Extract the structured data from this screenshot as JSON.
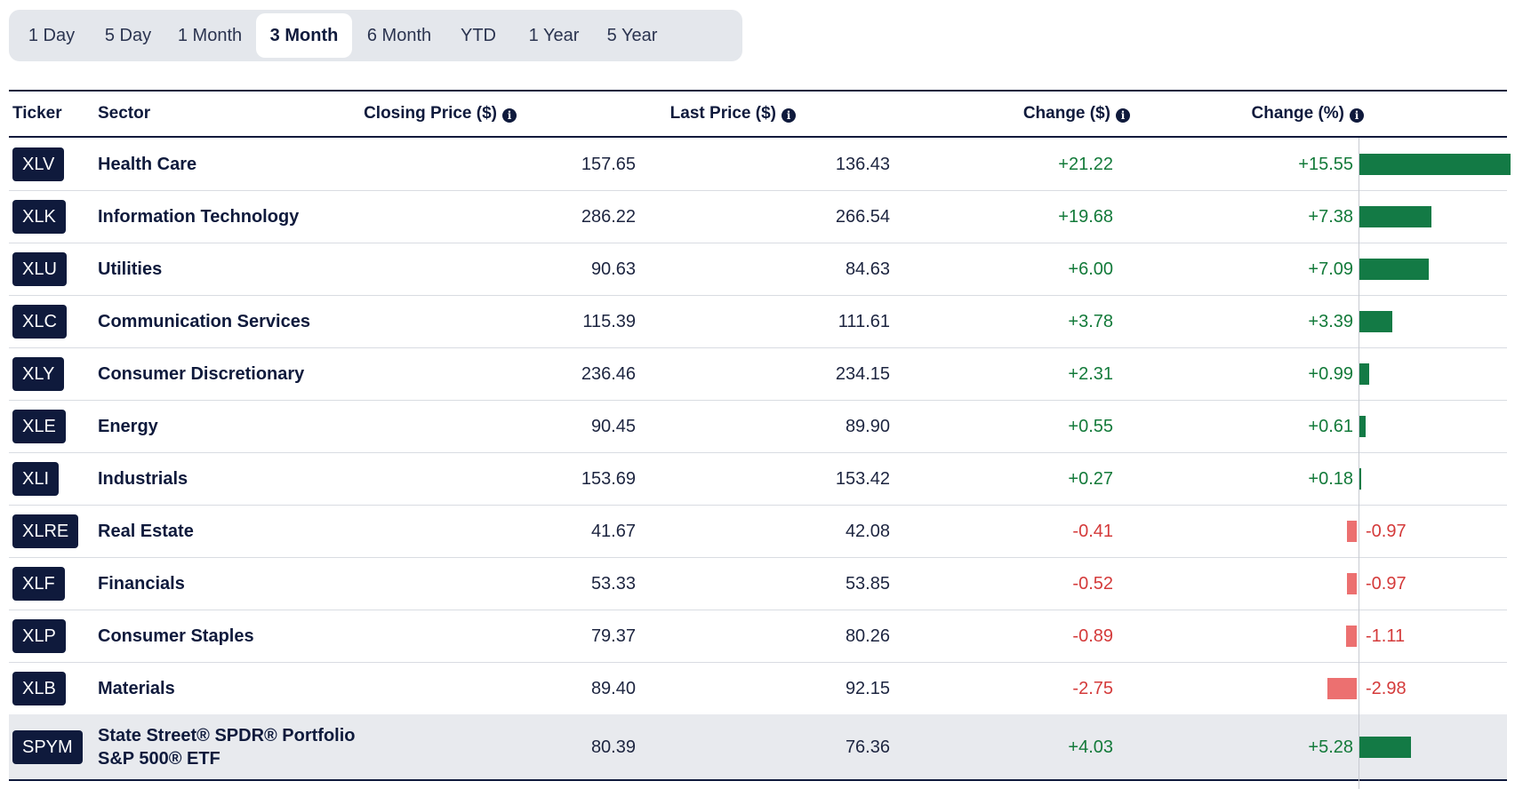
{
  "tabs": [
    {
      "label": "1 Day",
      "active": false
    },
    {
      "label": "5 Day",
      "active": false
    },
    {
      "label": "1 Month",
      "active": false
    },
    {
      "label": "3 Month",
      "active": true
    },
    {
      "label": "6 Month",
      "active": false
    },
    {
      "label": "YTD",
      "active": false
    },
    {
      "label": "1 Year",
      "active": false
    },
    {
      "label": "5 Year",
      "active": false
    }
  ],
  "headers": {
    "ticker": "Ticker",
    "sector": "Sector",
    "closing_price": "Closing Price ($)",
    "last_price": "Last Price ($)",
    "change_abs": "Change ($)",
    "change_pct": "Change (%)",
    "info_glyph": "i"
  },
  "rows": [
    {
      "ticker": "XLV",
      "sector": "Health Care",
      "closing": "157.65",
      "last": "136.43",
      "chg": "+21.22",
      "pct": "+15.55",
      "pct_value": 15.55
    },
    {
      "ticker": "XLK",
      "sector": "Information Technology",
      "closing": "286.22",
      "last": "266.54",
      "chg": "+19.68",
      "pct": "+7.38",
      "pct_value": 7.38
    },
    {
      "ticker": "XLU",
      "sector": "Utilities",
      "closing": "90.63",
      "last": "84.63",
      "chg": "+6.00",
      "pct": "+7.09",
      "pct_value": 7.09
    },
    {
      "ticker": "XLC",
      "sector": "Communication Services",
      "closing": "115.39",
      "last": "111.61",
      "chg": "+3.78",
      "pct": "+3.39",
      "pct_value": 3.39
    },
    {
      "ticker": "XLY",
      "sector": "Consumer Discretionary",
      "closing": "236.46",
      "last": "234.15",
      "chg": "+2.31",
      "pct": "+0.99",
      "pct_value": 0.99
    },
    {
      "ticker": "XLE",
      "sector": "Energy",
      "closing": "90.45",
      "last": "89.90",
      "chg": "+0.55",
      "pct": "+0.61",
      "pct_value": 0.61
    },
    {
      "ticker": "XLI",
      "sector": "Industrials",
      "closing": "153.69",
      "last": "153.42",
      "chg": "+0.27",
      "pct": "+0.18",
      "pct_value": 0.18
    },
    {
      "ticker": "XLRE",
      "sector": "Real Estate",
      "closing": "41.67",
      "last": "42.08",
      "chg": "-0.41",
      "pct": "-0.97",
      "pct_value": -0.97
    },
    {
      "ticker": "XLF",
      "sector": "Financials",
      "closing": "53.33",
      "last": "53.85",
      "chg": "-0.52",
      "pct": "-0.97",
      "pct_value": -0.97
    },
    {
      "ticker": "XLP",
      "sector": "Consumer Staples",
      "closing": "79.37",
      "last": "80.26",
      "chg": "-0.89",
      "pct": "-1.11",
      "pct_value": -1.11
    },
    {
      "ticker": "XLB",
      "sector": "Materials",
      "closing": "89.40",
      "last": "92.15",
      "chg": "-2.75",
      "pct": "-2.98",
      "pct_value": -2.98
    },
    {
      "ticker": "SPYM",
      "sector": "State Street® SPDR® Portfolio S&P 500® ETF",
      "sector_line1": "State Street® SPDR® Portfolio",
      "sector_line2": "S&P 500® ETF",
      "closing": "80.39",
      "last": "76.36",
      "chg": "+4.03",
      "pct": "+5.28",
      "pct_value": 5.28,
      "highlight": true
    }
  ],
  "colors": {
    "positive": "#137a3a",
    "positive_bar": "#137a45",
    "negative": "#d43a3a",
    "negative_bar": "#ec7070",
    "navy": "#0f1a3c"
  }
}
